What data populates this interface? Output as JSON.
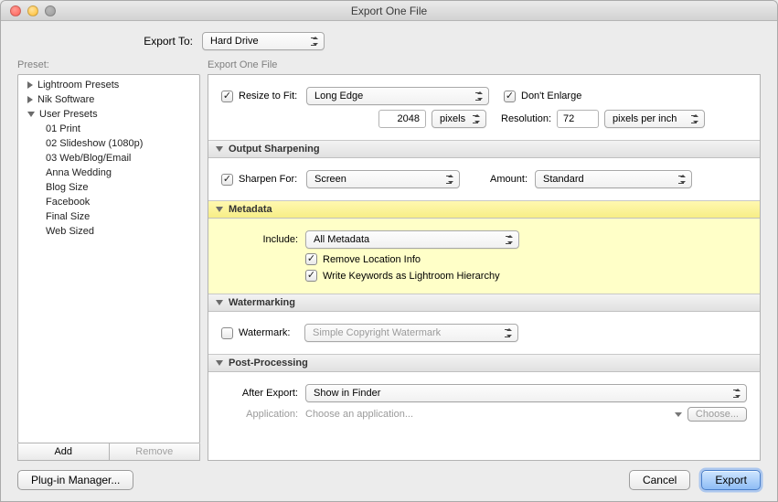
{
  "window": {
    "title": "Export One File"
  },
  "export_to": {
    "label": "Export To:",
    "value": "Hard Drive"
  },
  "preset": {
    "label": "Preset:",
    "groups": [
      {
        "name": "Lightroom Presets",
        "expanded": false
      },
      {
        "name": "Nik Software",
        "expanded": false
      },
      {
        "name": "User Presets",
        "expanded": true,
        "items": [
          "01 Print",
          "02 Slideshow (1080p)",
          "03 Web/Blog/Email",
          "Anna Wedding",
          "Blog Size",
          "Facebook",
          "Final Size",
          "Web Sized"
        ]
      }
    ],
    "add_label": "Add",
    "remove_label": "Remove"
  },
  "right_header": "Export One File",
  "resize": {
    "resize_label": "Resize to Fit:",
    "resize_checked": true,
    "mode": "Long Edge",
    "dont_enlarge_label": "Don't Enlarge",
    "dont_enlarge_checked": true,
    "size_value": "2048",
    "size_unit": "pixels",
    "resolution_label": "Resolution:",
    "resolution_value": "72",
    "resolution_unit": "pixels per inch"
  },
  "sharpen": {
    "title": "Output Sharpening",
    "for_label": "Sharpen For:",
    "for_checked": true,
    "for_value": "Screen",
    "amount_label": "Amount:",
    "amount_value": "Standard"
  },
  "metadata": {
    "title": "Metadata",
    "include_label": "Include:",
    "include_value": "All Metadata",
    "remove_location_label": "Remove Location Info",
    "remove_location_checked": true,
    "write_keywords_label": "Write Keywords as Lightroom Hierarchy",
    "write_keywords_checked": true
  },
  "watermark": {
    "title": "Watermarking",
    "label": "Watermark:",
    "checked": false,
    "value": "Simple Copyright Watermark"
  },
  "post": {
    "title": "Post-Processing",
    "after_label": "After Export:",
    "after_value": "Show in Finder",
    "app_label": "Application:",
    "app_placeholder": "Choose an application...",
    "choose_label": "Choose..."
  },
  "footer": {
    "plugin_label": "Plug-in Manager...",
    "cancel_label": "Cancel",
    "export_label": "Export"
  }
}
